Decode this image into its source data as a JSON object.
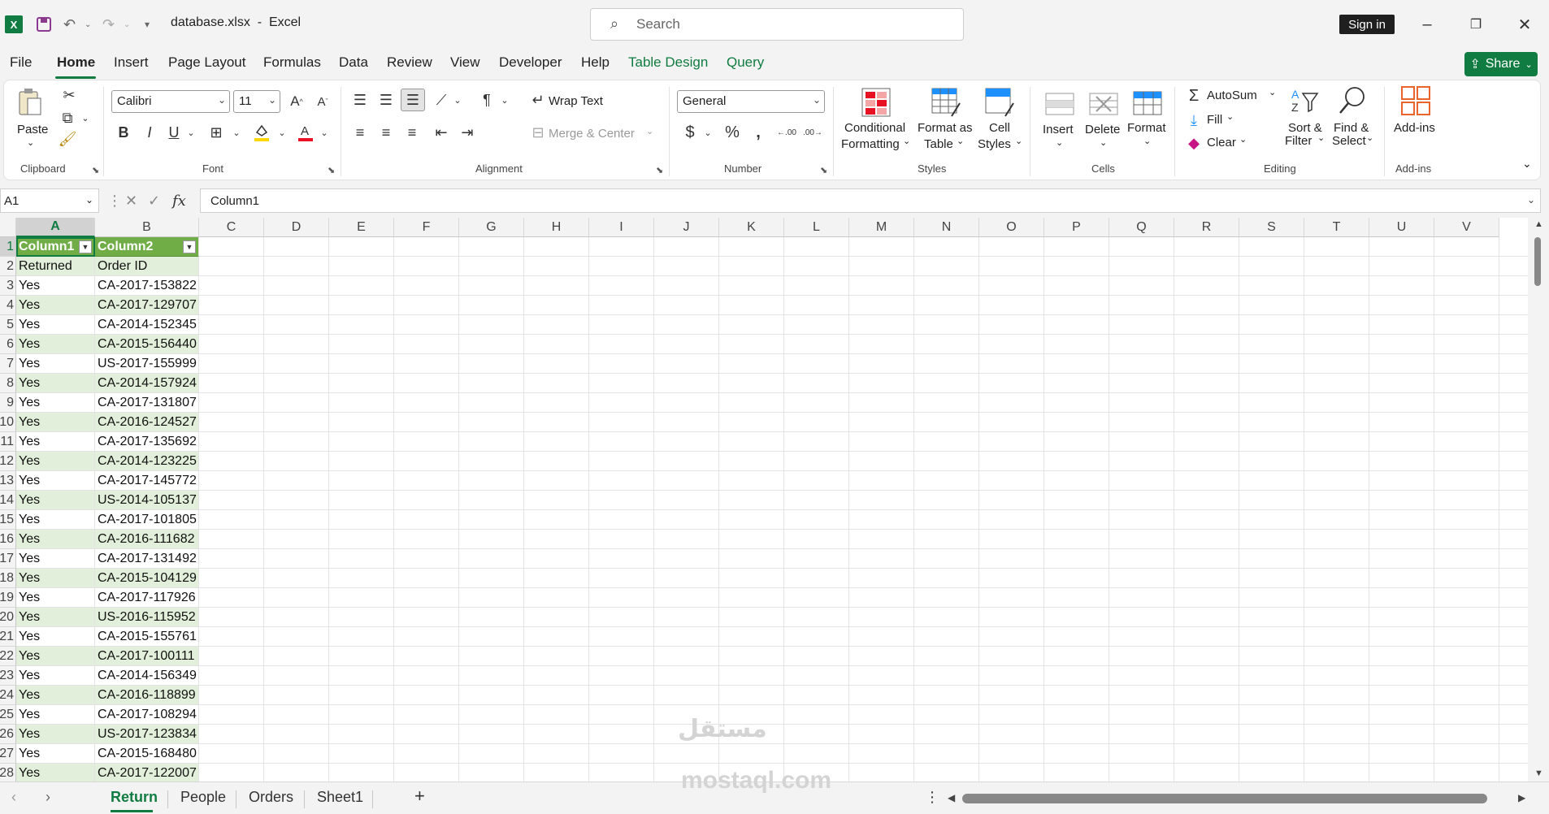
{
  "titlebar": {
    "file_name": "database.xlsx",
    "separator": "-",
    "app_name": "Excel",
    "search_placeholder": "Search",
    "sign_in": "Sign in"
  },
  "menu": {
    "items": [
      "File",
      "Home",
      "Insert",
      "Page Layout",
      "Formulas",
      "Data",
      "Review",
      "View",
      "Developer",
      "Help",
      "Table Design",
      "Query"
    ],
    "active": "Home",
    "share": "Share"
  },
  "ribbon": {
    "clipboard": {
      "label": "Clipboard",
      "paste": "Paste"
    },
    "font": {
      "label": "Font",
      "font_name": "Calibri",
      "font_size": "11"
    },
    "alignment": {
      "label": "Alignment",
      "wrap_text": "Wrap Text",
      "merge_center": "Merge & Center"
    },
    "number": {
      "label": "Number",
      "format": "General"
    },
    "styles": {
      "label": "Styles",
      "conditional_1": "Conditional",
      "conditional_2": "Formatting",
      "format_table_1": "Format as",
      "format_table_2": "Table",
      "cell_styles_1": "Cell",
      "cell_styles_2": "Styles"
    },
    "cells": {
      "label": "Cells",
      "insert": "Insert",
      "delete": "Delete",
      "format": "Format"
    },
    "editing": {
      "label": "Editing",
      "autosum": "AutoSum",
      "fill": "Fill",
      "clear": "Clear",
      "sort_1": "Sort &",
      "sort_2": "Filter",
      "find_1": "Find &",
      "find_2": "Select"
    },
    "addins": {
      "label": "Add-ins",
      "addins": "Add-ins"
    }
  },
  "formula_bar": {
    "name_box": "A1",
    "formula": "Column1"
  },
  "sheet": {
    "columns": [
      "A",
      "B",
      "C",
      "D",
      "E",
      "F",
      "G",
      "H",
      "I",
      "J",
      "K",
      "L",
      "M",
      "N",
      "O",
      "P",
      "Q",
      "R",
      "S",
      "T",
      "U",
      "V"
    ],
    "row_numbers": [
      "1",
      "2",
      "3",
      "4",
      "5",
      "6",
      "7",
      "8",
      "9",
      "10",
      "11",
      "12",
      "13",
      "14",
      "15",
      "16",
      "17",
      "18",
      "19",
      "20",
      "21",
      "22",
      "23",
      "24",
      "25",
      "26",
      "27",
      "28"
    ],
    "header": [
      "Column1",
      "Column2"
    ],
    "subheader": [
      "Returned",
      "Order ID"
    ],
    "rows": [
      [
        "Yes",
        "CA-2017-153822"
      ],
      [
        "Yes",
        "CA-2017-129707"
      ],
      [
        "Yes",
        "CA-2014-152345"
      ],
      [
        "Yes",
        "CA-2015-156440"
      ],
      [
        "Yes",
        "US-2017-155999"
      ],
      [
        "Yes",
        "CA-2014-157924"
      ],
      [
        "Yes",
        "CA-2017-131807"
      ],
      [
        "Yes",
        "CA-2016-124527"
      ],
      [
        "Yes",
        "CA-2017-135692"
      ],
      [
        "Yes",
        "CA-2014-123225"
      ],
      [
        "Yes",
        "CA-2017-145772"
      ],
      [
        "Yes",
        "US-2014-105137"
      ],
      [
        "Yes",
        "CA-2017-101805"
      ],
      [
        "Yes",
        "CA-2016-111682"
      ],
      [
        "Yes",
        "CA-2017-131492"
      ],
      [
        "Yes",
        "CA-2015-104129"
      ],
      [
        "Yes",
        "CA-2017-117926"
      ],
      [
        "Yes",
        "US-2016-115952"
      ],
      [
        "Yes",
        "CA-2015-155761"
      ],
      [
        "Yes",
        "CA-2017-100111"
      ],
      [
        "Yes",
        "CA-2014-156349"
      ],
      [
        "Yes",
        "CA-2016-118899"
      ],
      [
        "Yes",
        "CA-2017-108294"
      ],
      [
        "Yes",
        "US-2017-123834"
      ],
      [
        "Yes",
        "CA-2015-168480"
      ],
      [
        "Yes",
        "CA-2017-122007"
      ]
    ]
  },
  "tabs": {
    "items": [
      "Return",
      "People",
      "Orders",
      "Sheet1"
    ],
    "active": "Return"
  },
  "watermark": {
    "arabic": "مستقل",
    "latin": "mostaql.com"
  },
  "colors": {
    "accent": "#107c41",
    "table_header": "#70ad47",
    "band": "#e2efda"
  }
}
